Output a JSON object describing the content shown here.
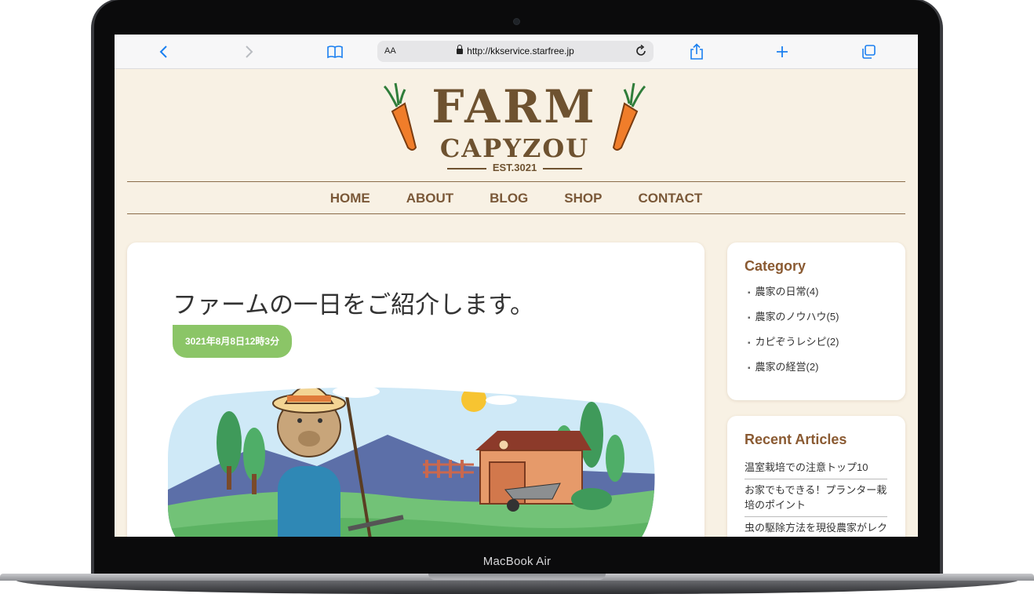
{
  "device": {
    "label": "MacBook Air"
  },
  "browser": {
    "text_size_label": "AA",
    "url": "http://kkservice.starfree.jp",
    "icons": [
      "back-icon",
      "forward-icon",
      "bookmarks-icon",
      "share-icon",
      "new-tab-icon",
      "tabs-icon",
      "reload-icon",
      "lock-icon"
    ],
    "accent_color": "#1a7ff0"
  },
  "site": {
    "logo": {
      "line1": "FARM",
      "line2": "CAPYZOU",
      "line3": "EST.3021"
    },
    "nav": [
      "HOME",
      "ABOUT",
      "BLOG",
      "SHOP",
      "CONTACT"
    ],
    "colors": {
      "brand_brown": "#7a5838",
      "badge_green": "#8bc567",
      "page_bg": "#f8f1e4"
    }
  },
  "post": {
    "title": "ファームの一日をご紹介します。",
    "date": "3021年8月8日12時3分",
    "image": "capybara-farmer-illustration"
  },
  "sidebar": {
    "category": {
      "heading": "Category",
      "items": [
        "農家の日常(4)",
        "農家のノウハウ(5)",
        "カピぞうレシピ(2)",
        "農家の経営(2)"
      ]
    },
    "recent": {
      "heading": "Recent Articles",
      "items": [
        "温室栽培での注意トップ10",
        "お家でもできる！プランター栽培のポイント",
        "虫の駆除方法を現役農家がレク"
      ]
    }
  }
}
